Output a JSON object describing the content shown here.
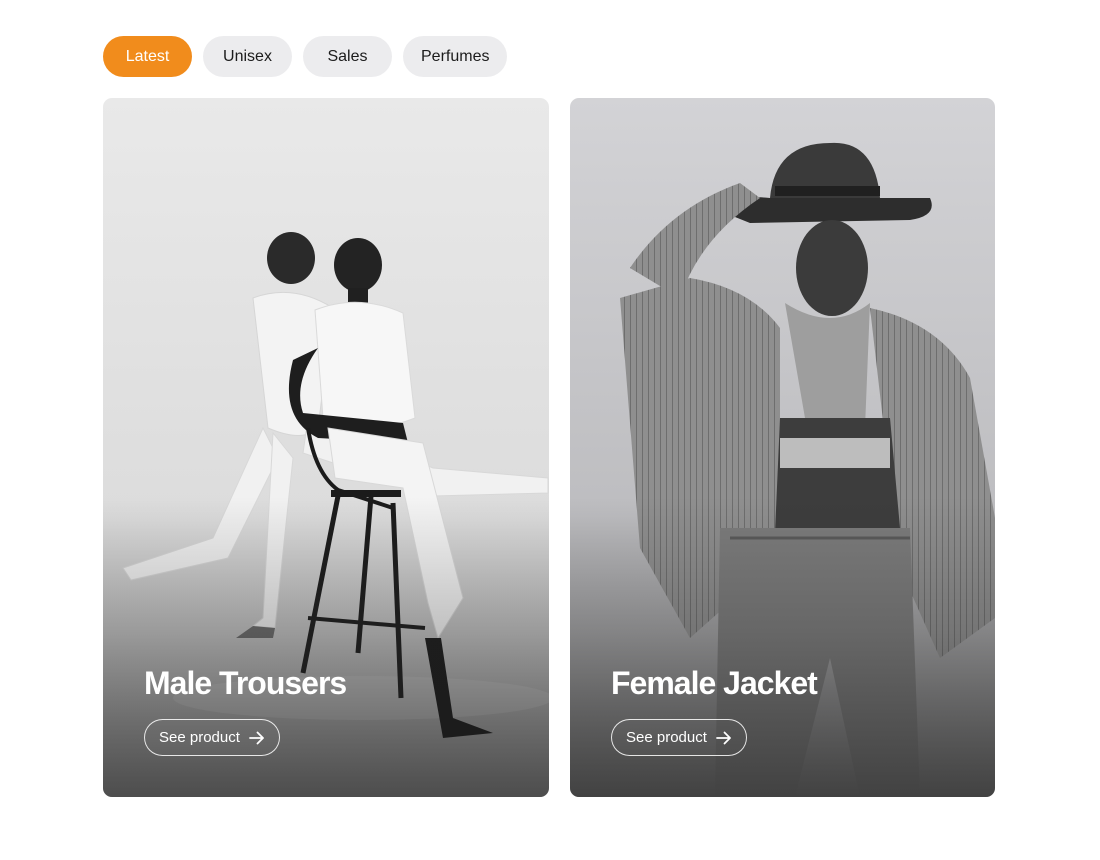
{
  "filters": [
    {
      "label": "Latest",
      "active": true
    },
    {
      "label": "Unisex",
      "active": false
    },
    {
      "label": "Sales",
      "active": false
    },
    {
      "label": "Perfumes",
      "active": false
    }
  ],
  "products": [
    {
      "title": "Male Trousers",
      "cta_label": "See product",
      "cta_icon": "arrow-right-icon",
      "image": "black-and-white photo of two models in white outfits, one seated on a bar stool"
    },
    {
      "title": "Female Jacket",
      "cta_label": "See product",
      "cta_icon": "arrow-right-icon",
      "image": "black-and-white photo of a woman in a wide-brim hat, striped jacket and jeans"
    }
  ],
  "colors": {
    "accent": "#f18c1c",
    "chip_bg": "#ececee",
    "chip_text": "#1c1c1c",
    "card_text": "#ffffff"
  }
}
